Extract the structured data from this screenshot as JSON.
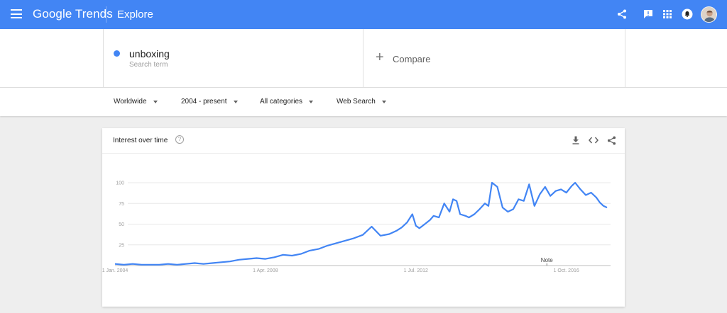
{
  "topbar": {
    "brand": "Google Trends",
    "page_title": "Explore",
    "icons": [
      "menu-icon",
      "share-icon",
      "feedback-icon",
      "apps-icon",
      "notifications-icon",
      "avatar"
    ]
  },
  "search": {
    "term": "unboxing",
    "term_type": "Search term",
    "term_color": "#4285f4",
    "compare_label": "Compare"
  },
  "filters": {
    "region": "Worldwide",
    "time": "2004 - present",
    "category": "All categories",
    "property": "Web Search"
  },
  "card": {
    "title": "Interest over time",
    "help": "?",
    "icons": [
      "download-icon",
      "embed-icon",
      "share-icon"
    ]
  },
  "chart_data": {
    "type": "line",
    "title": "Interest over time",
    "series": [
      {
        "name": "unboxing",
        "color": "#4285f4",
        "x": [
          2004.0,
          2004.25,
          2004.5,
          2004.75,
          2005.0,
          2005.25,
          2005.5,
          2005.75,
          2006.0,
          2006.25,
          2006.5,
          2006.75,
          2007.0,
          2007.25,
          2007.5,
          2007.75,
          2008.0,
          2008.25,
          2008.5,
          2008.75,
          2009.0,
          2009.25,
          2009.5,
          2009.75,
          2010.0,
          2010.25,
          2010.5,
          2010.75,
          2011.0,
          2011.25,
          2011.5,
          2011.75,
          2011.95,
          2012.1,
          2012.25,
          2012.4,
          2012.5,
          2012.6,
          2012.75,
          2012.9,
          2013.0,
          2013.15,
          2013.3,
          2013.45,
          2013.55,
          2013.65,
          2013.75,
          2013.9,
          2014.0,
          2014.15,
          2014.3,
          2014.45,
          2014.55,
          2014.65,
          2014.8,
          2014.95,
          2015.1,
          2015.25,
          2015.4,
          2015.55,
          2015.7,
          2015.85,
          2016.0,
          2016.15,
          2016.3,
          2016.45,
          2016.6,
          2016.75,
          2016.9,
          2017.0,
          2017.15,
          2017.3,
          2017.45,
          2017.6,
          2017.7,
          2017.8,
          2017.9
        ],
        "values": [
          2,
          1,
          2,
          1,
          1,
          1,
          2,
          1,
          2,
          3,
          2,
          3,
          4,
          5,
          7,
          8,
          9,
          8,
          10,
          13,
          12,
          14,
          18,
          20,
          24,
          27,
          30,
          33,
          37,
          47,
          36,
          38,
          42,
          46,
          52,
          62,
          48,
          45,
          50,
          55,
          60,
          58,
          75,
          65,
          80,
          78,
          62,
          60,
          58,
          62,
          68,
          75,
          72,
          100,
          95,
          70,
          65,
          68,
          80,
          78,
          98,
          72,
          86,
          95,
          84,
          90,
          92,
          88,
          96,
          100,
          92,
          85,
          88,
          82,
          76,
          72,
          70
        ]
      }
    ],
    "xlim": [
      2004.0,
      2018.0
    ],
    "ylim": [
      0,
      100
    ],
    "yticks": [
      25,
      50,
      75,
      100
    ],
    "xticks": [
      {
        "value": 2004.0,
        "label": "1 Jan. 2004"
      },
      {
        "value": 2008.25,
        "label": "1 Apr. 2008"
      },
      {
        "value": 2012.5,
        "label": "1 Jul. 2012"
      },
      {
        "value": 2016.75,
        "label": "1 Oct. 2016"
      }
    ],
    "annotation": {
      "x": 2016.2,
      "label": "Note"
    },
    "grid": true
  }
}
